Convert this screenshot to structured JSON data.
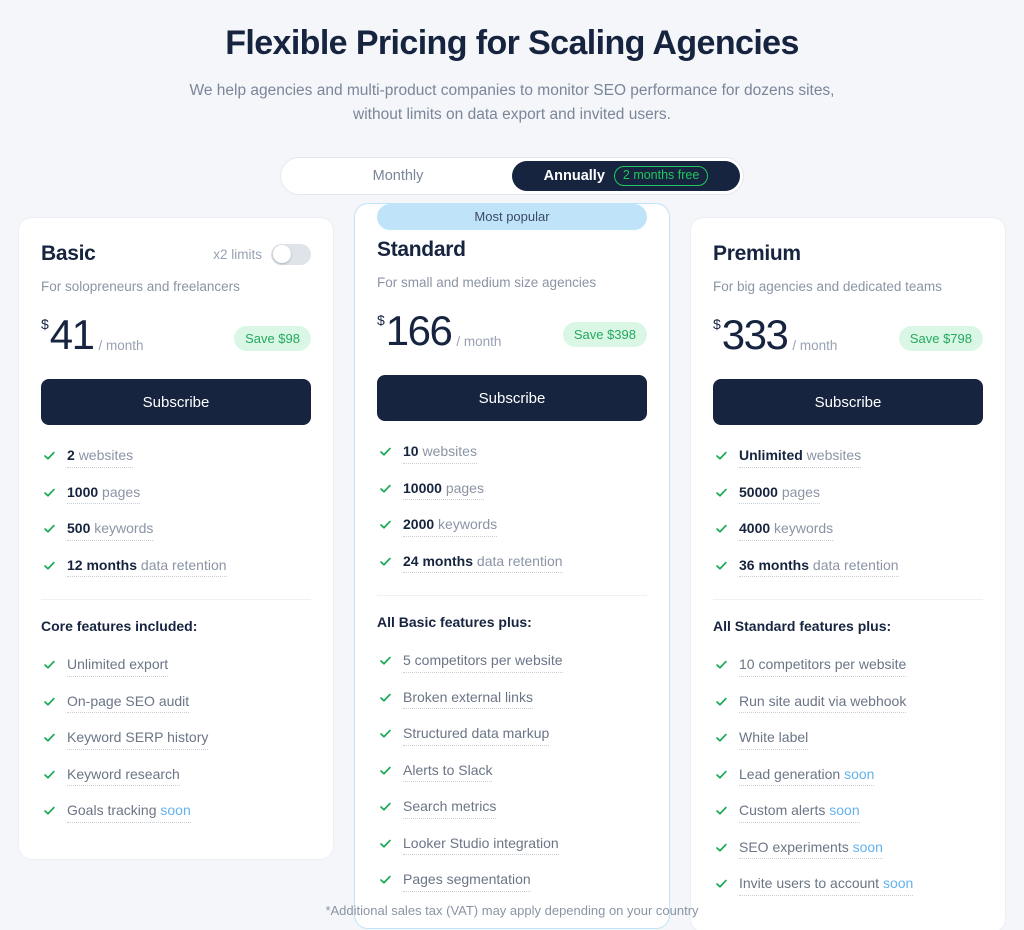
{
  "header": {
    "title": "Flexible Pricing for Scaling Agencies",
    "subtitle": "We help agencies and multi-product companies to monitor SEO performance for dozens sites, without limits on data export and invited users."
  },
  "billing": {
    "monthly_label": "Monthly",
    "annually_label": "Annually",
    "annual_badge": "2 months free",
    "selected": "Annually"
  },
  "colors": {
    "page_bg": "#f4f6f9",
    "navy": "#16243f",
    "green": "#22c55e",
    "save_pill_bg": "#d9f7e4",
    "save_pill_text": "#26a860",
    "popular_badge_bg": "#bfe4fa",
    "soon_blue": "#63b3ed",
    "featured_border": "#bfe3f8"
  },
  "plans": [
    {
      "name": "Basic",
      "description": "For solopreneurs and freelancers",
      "limits_label": "x2 limits",
      "limits_toggle_on": false,
      "currency": "$",
      "price": "41",
      "period": "/ month",
      "save_label": "Save $98",
      "cta": "Subscribe",
      "badge": null,
      "quotas": [
        {
          "value": "2",
          "unit": "websites"
        },
        {
          "value": "1000",
          "unit": "pages"
        },
        {
          "value": "500",
          "unit": "keywords"
        },
        {
          "value": "12 months",
          "unit": "data retention"
        }
      ],
      "features_title": "Core features included:",
      "features": [
        {
          "label": "Unlimited export",
          "soon": ""
        },
        {
          "label": "On-page SEO audit",
          "soon": ""
        },
        {
          "label": "Keyword SERP history",
          "soon": ""
        },
        {
          "label": "Keyword research",
          "soon": ""
        },
        {
          "label": "Goals tracking",
          "soon": "soon"
        }
      ]
    },
    {
      "name": "Standard",
      "description": "For small and medium size agencies",
      "limits_label": "",
      "limits_toggle_on": false,
      "currency": "$",
      "price": "166",
      "period": "/ month",
      "save_label": "Save $398",
      "cta": "Subscribe",
      "badge": "Most popular",
      "quotas": [
        {
          "value": "10",
          "unit": "websites"
        },
        {
          "value": "10000",
          "unit": "pages"
        },
        {
          "value": "2000",
          "unit": "keywords"
        },
        {
          "value": "24 months",
          "unit": "data retention"
        }
      ],
      "features_title": "All Basic features plus:",
      "features": [
        {
          "label": "5 competitors per website",
          "soon": ""
        },
        {
          "label": "Broken external links",
          "soon": ""
        },
        {
          "label": "Structured data markup",
          "soon": ""
        },
        {
          "label": "Alerts to Slack",
          "soon": ""
        },
        {
          "label": "Search metrics",
          "soon": ""
        },
        {
          "label": "Looker Studio integration",
          "soon": ""
        },
        {
          "label": "Pages segmentation",
          "soon": ""
        }
      ]
    },
    {
      "name": "Premium",
      "description": "For big agencies and dedicated teams",
      "limits_label": "",
      "limits_toggle_on": false,
      "currency": "$",
      "price": "333",
      "period": "/ month",
      "save_label": "Save $798",
      "cta": "Subscribe",
      "badge": null,
      "quotas": [
        {
          "value": "Unlimited",
          "unit": "websites"
        },
        {
          "value": "50000",
          "unit": "pages"
        },
        {
          "value": "4000",
          "unit": "keywords"
        },
        {
          "value": "36 months",
          "unit": "data retention"
        }
      ],
      "features_title": "All Standard features plus:",
      "features": [
        {
          "label": "10 competitors per website",
          "soon": ""
        },
        {
          "label": "Run site audit via webhook",
          "soon": ""
        },
        {
          "label": "White label",
          "soon": ""
        },
        {
          "label": "Lead generation",
          "soon": "soon"
        },
        {
          "label": "Custom alerts",
          "soon": "soon"
        },
        {
          "label": "SEO experiments",
          "soon": "soon"
        },
        {
          "label": "Invite users to account",
          "soon": "soon"
        }
      ]
    }
  ],
  "footnote": "*Additional sales tax (VAT) may apply depending on your country"
}
